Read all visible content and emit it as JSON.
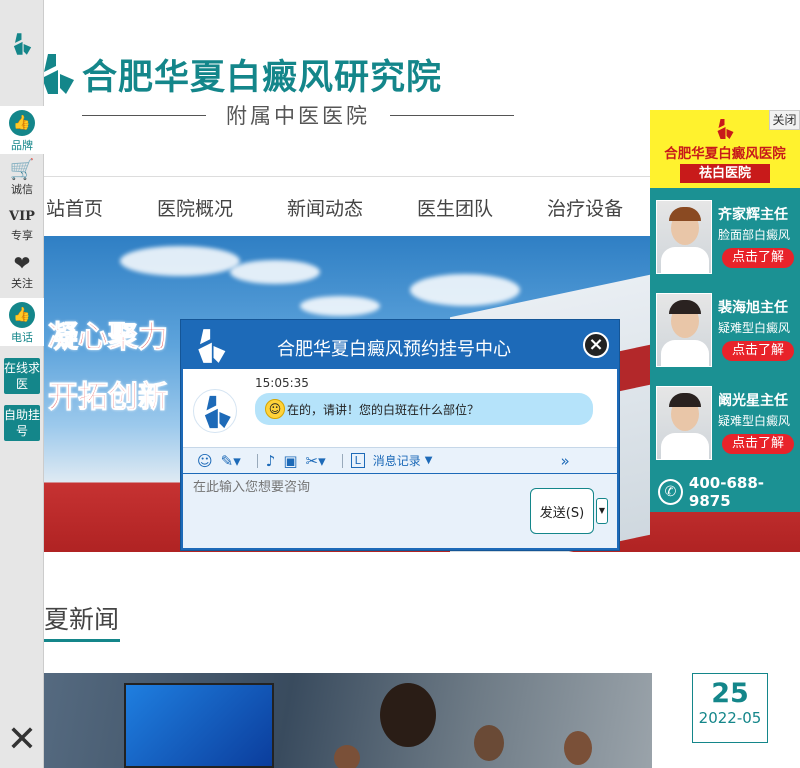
{
  "header": {
    "logo_title": "合肥华夏白癜风研究院",
    "subtitle": "附属中医医院"
  },
  "nav": {
    "items": [
      "站首页",
      "医院概况",
      "新闻动态",
      "医生团队",
      "治疗设备"
    ]
  },
  "banner": {
    "line1": "凝心聚力",
    "line2": "开拓创新"
  },
  "section": {
    "title": "夏新闻"
  },
  "news": {
    "day": "25",
    "year_month": "2022-05"
  },
  "leftbar": {
    "items": [
      {
        "label": "品牌",
        "icon": "thumbs-up-icon"
      },
      {
        "label": "诚信",
        "icon": "cart-icon"
      },
      {
        "label": "专享",
        "icon": "vip-icon",
        "badge": "VIP"
      },
      {
        "label": "关注",
        "icon": "heart-icon"
      },
      {
        "label": "电话",
        "icon": "thumbs-up-icon"
      }
    ],
    "btn_online": "在线求医",
    "btn_booking": "自助挂号",
    "close": "✕"
  },
  "chat": {
    "title": "合肥华夏白癜风预约挂号中心",
    "time": "15:05:35",
    "message": "在的，请讲！您的白斑在什么部位？",
    "history": "消息记录",
    "input_placeholder": "在此输入您想要咨询",
    "send": "发送(S)"
  },
  "right_panel": {
    "close": "关闭",
    "hospital": "合肥华夏白癜风医院",
    "sub": "祛白医院",
    "doctors": [
      {
        "name": "齐家辉主任",
        "dept": "脸面部白癜风",
        "cta": "点击了解"
      },
      {
        "name": "裴海旭主任",
        "dept": "疑难型白癜风",
        "cta": "点击了解"
      },
      {
        "name": "阚光星主任",
        "dept": "疑难型白癜风",
        "cta": "点击了解"
      }
    ],
    "phone": "400-688-9875"
  },
  "colors": {
    "brand": "#14868a",
    "chat_blue": "#1d6ab8",
    "cta_red": "#e8232a",
    "panel_yellow": "#fff22e"
  }
}
